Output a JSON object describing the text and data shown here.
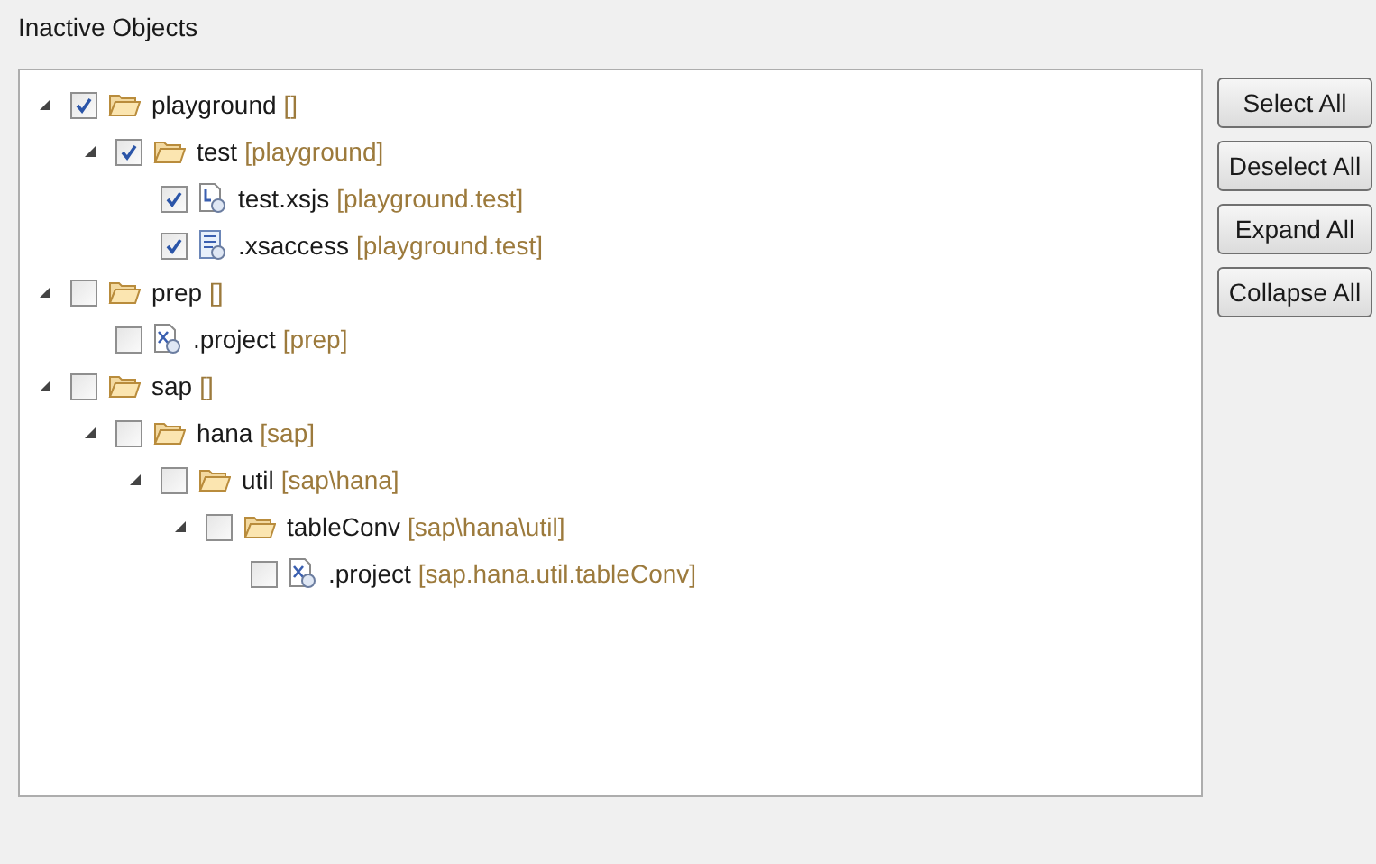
{
  "title": "Inactive Objects",
  "tree": [
    {
      "name": "playground",
      "path": "[]",
      "kind": "folder",
      "checked": true,
      "expanded": true,
      "children": [
        {
          "name": "test",
          "path": "[playground]",
          "kind": "folder",
          "checked": true,
          "expanded": true,
          "children": [
            {
              "name": "test.xsjs",
              "path": "[playground.test]",
              "kind": "script",
              "checked": true
            },
            {
              "name": ".xsaccess",
              "path": "[playground.test]",
              "kind": "access",
              "checked": true
            }
          ]
        }
      ]
    },
    {
      "name": "prep",
      "path": "[]",
      "kind": "folder",
      "checked": false,
      "expanded": true,
      "children": [
        {
          "name": ".project",
          "path": "[prep]",
          "kind": "project",
          "checked": false
        }
      ]
    },
    {
      "name": "sap",
      "path": "[]",
      "kind": "folder",
      "checked": false,
      "expanded": true,
      "children": [
        {
          "name": "hana",
          "path": "[sap]",
          "kind": "folder",
          "checked": false,
          "expanded": true,
          "children": [
            {
              "name": "util",
              "path": "[sap\\hana]",
              "kind": "folder",
              "checked": false,
              "expanded": true,
              "children": [
                {
                  "name": "tableConv",
                  "path": "[sap\\hana\\util]",
                  "kind": "folder",
                  "checked": false,
                  "expanded": true,
                  "children": [
                    {
                      "name": ".project",
                      "path": "[sap.hana.util.tableConv]",
                      "kind": "project",
                      "checked": false
                    }
                  ]
                }
              ]
            }
          ]
        }
      ]
    }
  ],
  "buttons": [
    "Select All",
    "Deselect All",
    "Expand All",
    "Collapse All"
  ]
}
